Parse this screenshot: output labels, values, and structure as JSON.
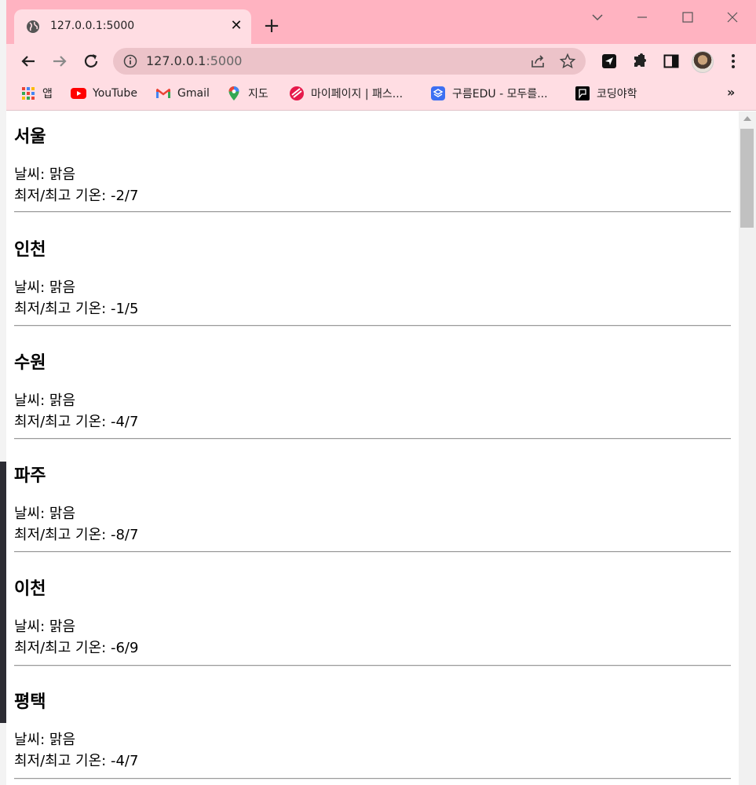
{
  "browser": {
    "tab": {
      "title": "127.0.0.1:5000",
      "close": "✕"
    },
    "new_tab": "+",
    "address": {
      "host": "127.0.0.1",
      "rest": ":5000"
    },
    "bookmarks": [
      {
        "label": "앱",
        "icon": "apps-grid-icon"
      },
      {
        "label": "YouTube",
        "icon": "youtube-icon"
      },
      {
        "label": "Gmail",
        "icon": "gmail-icon"
      },
      {
        "label": "지도",
        "icon": "maps-pin-icon"
      },
      {
        "label": "마이페이지 | 패스...",
        "icon": "passport-icon"
      },
      {
        "label": "구름EDU - 모두를...",
        "icon": "goorm-icon"
      },
      {
        "label": "코딩야학",
        "icon": "coding-icon"
      }
    ],
    "bookmarks_more": "»"
  },
  "page": {
    "weather_label": "날씨:",
    "temp_label": "최저/최고 기온:",
    "cities": [
      {
        "name": "서울",
        "weather": "맑음",
        "temp": "-2/7"
      },
      {
        "name": "인천",
        "weather": "맑음",
        "temp": "-1/5"
      },
      {
        "name": "수원",
        "weather": "맑음",
        "temp": "-4/7"
      },
      {
        "name": "파주",
        "weather": "맑음",
        "temp": "-8/7"
      },
      {
        "name": "이천",
        "weather": "맑음",
        "temp": "-6/9"
      },
      {
        "name": "평택",
        "weather": "맑음",
        "temp": "-4/7"
      }
    ]
  },
  "colors": {
    "tabstrip": "#ffb3c1",
    "toolbar": "#ffdde3",
    "omnibox": "#ecc3c9"
  }
}
